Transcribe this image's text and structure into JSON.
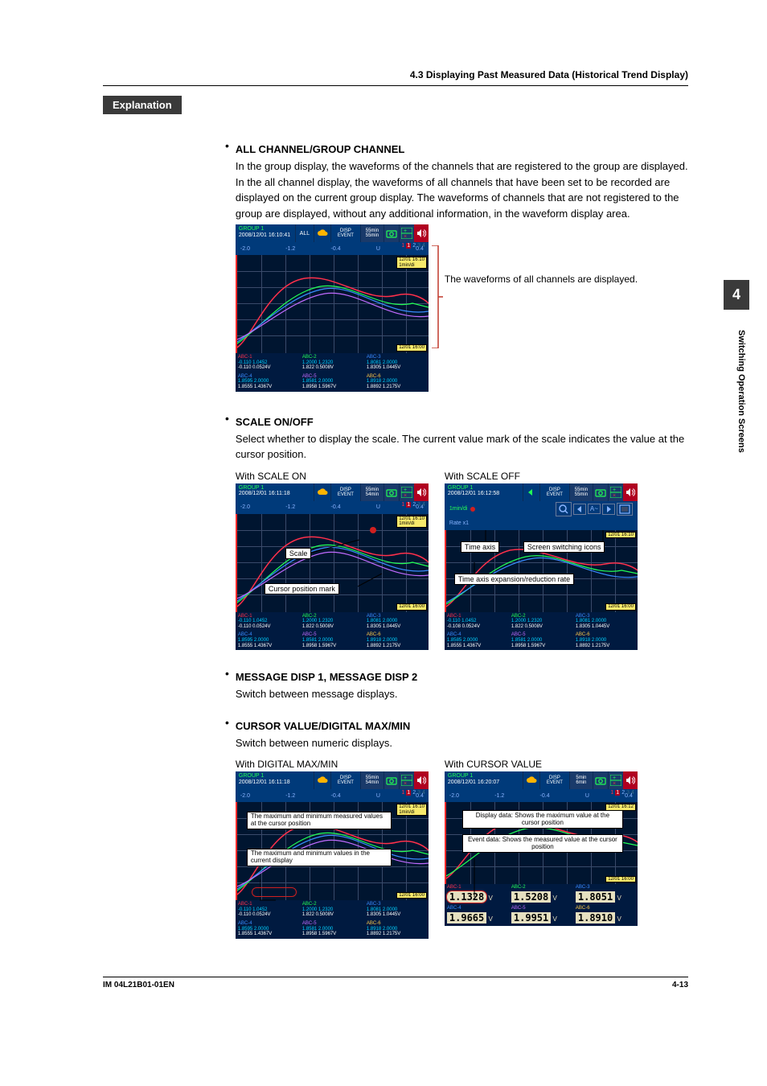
{
  "running_head": "4.3  Displaying Past Measured Data (Historical Trend Display)",
  "explanation_label": "Explanation",
  "side_tab": "4",
  "side_text": "Switching Operation Screens",
  "footer_left": "IM 04L21B01-01EN",
  "footer_right": "4-13",
  "sec1": {
    "title": "ALL CHANNEL/GROUP CHANNEL",
    "body": "In the group display, the waveforms of the channels that are registered to the group are displayed. In the all channel display, the waveforms of all channels that have been set to be recorded are displayed on the current group display. The waveforms of channels that are not registered to the group are displayed, without any additional information, in the waveform display area.",
    "callout": "The waveforms of all channels are displayed.",
    "fig": {
      "group": "GROUP 1",
      "datetime": "2008/12/01 16:10:41",
      "all": "ALL",
      "disp": "DISP",
      "event": "EVENT",
      "min1": "55min",
      "min2": "55min",
      "ticks": [
        "-2.0",
        "-1.2",
        "-0.4",
        "U",
        "0.4"
      ],
      "ind": [
        "1",
        "1",
        "2",
        "3",
        "4"
      ],
      "y1": "12/01 16:10",
      "y2": "1min/di",
      "yb": "12/01 16:00",
      "cells": [
        {
          "ch": "ABC-1",
          "c": "#ff304b",
          "a": "-0.110 1.0452",
          "b": "-0.110 0.0524V"
        },
        {
          "ch": "ABC-2",
          "c": "#22ff55",
          "a": "1.2000 1.2320",
          "b": "1.822 0.5008V"
        },
        {
          "ch": "ABC-3",
          "c": "#3a8bff",
          "a": "1.8081 2.0000",
          "b": "1.8305 1.0445V"
        },
        {
          "ch": "ABC-4",
          "c": "#3a8bff",
          "a": "1.8595 2.0000",
          "b": "1.8555 1.4367V"
        },
        {
          "ch": "ABC-5",
          "c": "#c26bff",
          "a": "1.8581 2.0000",
          "b": "1.8958 1.5967V"
        },
        {
          "ch": "ABC-6",
          "c": "#ffc84a",
          "a": "1.8918 2.0000",
          "b": "1.8892 1.2175V"
        }
      ]
    }
  },
  "sec2": {
    "title": "SCALE ON/OFF",
    "body": "Select whether to display the scale. The current value mark of the scale indicates the value at the cursor position.",
    "cap_on": "With SCALE ON",
    "cap_off": "With SCALE OFF",
    "label_scale": "Scale",
    "label_cursor": "Cursor position mark",
    "label_timeaxis": "Time axis",
    "label_switch": "Screen switching icons",
    "label_rate": "Time axis expansion/reduction rate",
    "fig_on": {
      "group": "GROUP 1",
      "datetime": "2008/12/01 16:11:18",
      "disp": "DISP",
      "event": "EVENT",
      "min1": "55min",
      "min2": "54min",
      "ticks": [
        "-2.0",
        "-1.2",
        "-0.4",
        "U",
        "0.4"
      ],
      "ind": [
        "1",
        "1",
        "2",
        "3",
        "4"
      ],
      "y1": "12/01 16:10",
      "y2": "1min/di",
      "yb": "12/01 16:00",
      "cells": [
        {
          "ch": "ABC-1",
          "c": "#ff304b",
          "a": "-0.110 1.0452",
          "b": "-0.110 0.0524V"
        },
        {
          "ch": "ABC-2",
          "c": "#22ff55",
          "a": "1.2000 1.2320",
          "b": "1.822 0.5008V"
        },
        {
          "ch": "ABC-3",
          "c": "#3a8bff",
          "a": "1.8081 2.0000",
          "b": "1.8305 1.0445V"
        },
        {
          "ch": "ABC-4",
          "c": "#3a8bff",
          "a": "1.8595 2.0000",
          "b": "1.8555 1.4367V"
        },
        {
          "ch": "ABC-5",
          "c": "#c26bff",
          "a": "1.8581 2.0000",
          "b": "1.8958 1.5967V"
        },
        {
          "ch": "ABC-6",
          "c": "#ffc84a",
          "a": "1.8918 2.0000",
          "b": "1.8892 1.2175V"
        }
      ]
    },
    "fig_off": {
      "group": "GROUP 1",
      "datetime": "2008/12/01 16:12:58",
      "disp": "DISP",
      "event": "EVENT",
      "min1": "55min",
      "min2": "55min",
      "div": "1min/di",
      "rate": "Rate x1",
      "y1": "12/01 16:10",
      "yb": "12/01 16:00",
      "cells": [
        {
          "ch": "ABC-1",
          "c": "#ff304b",
          "a": "-0.110 1.0452",
          "b": "-0.108 0.0524V"
        },
        {
          "ch": "ABC-2",
          "c": "#22ff55",
          "a": "1.2000 1.2320",
          "b": "1.822 0.5008V"
        },
        {
          "ch": "ABC-3",
          "c": "#3a8bff",
          "a": "1.8081 2.0000",
          "b": "1.8305 1.0445V"
        },
        {
          "ch": "ABC-4",
          "c": "#3a8bff",
          "a": "1.8585 2.0000",
          "b": "1.8555 1.4367V"
        },
        {
          "ch": "ABC-5",
          "c": "#c26bff",
          "a": "1.8581 2.0000",
          "b": "1.8958 1.5967V"
        },
        {
          "ch": "ABC-6",
          "c": "#ffc84a",
          "a": "1.8918 2.0000",
          "b": "1.8892 1.2175V"
        }
      ]
    }
  },
  "sec3": {
    "title": "MESSAGE DISP 1, MESSAGE DISP 2",
    "body": "Switch between message displays."
  },
  "sec4": {
    "title": "CURSOR VALUE/DIGITAL MAX/MIN",
    "body": "Switch between numeric displays.",
    "cap_left": "With DIGITAL MAX/MIN",
    "cap_right": "With CURSOR VALUE",
    "left": {
      "group": "GROUP 1",
      "datetime": "2008/12/01 16:11:18",
      "disp": "DISP",
      "event": "EVENT",
      "min1": "55min",
      "min2": "54min",
      "ticks": [
        "-2.0",
        "-1.2",
        "-0.4",
        "U",
        "0.4"
      ],
      "ind": [
        "1",
        "1",
        "2",
        "3",
        "4"
      ],
      "y1": "12/01 16:10",
      "y2": "1min/di",
      "yb": "12/01 16:00",
      "cbox1": "The maximum and minimum measured values at the cursor position",
      "cbox2": "The maximum and minimum values in the current display",
      "cells": [
        {
          "ch": "ABC-1",
          "c": "#ff304b",
          "a": "-0.110 1.0452",
          "b": "-0.110 0.0524V"
        },
        {
          "ch": "ABC-2",
          "c": "#22ff55",
          "a": "1.2000 1.2320",
          "b": "1.822 0.5008V"
        },
        {
          "ch": "ABC-3",
          "c": "#3a8bff",
          "a": "1.8081 2.0000",
          "b": "1.8305 1.0445V"
        },
        {
          "ch": "ABC-4",
          "c": "#3a8bff",
          "a": "1.8595 2.0000",
          "b": "1.8555 1.4367V"
        },
        {
          "ch": "ABC-5",
          "c": "#c26bff",
          "a": "1.8581 2.0000",
          "b": "1.8958 1.5967V"
        },
        {
          "ch": "ABC-6",
          "c": "#ffc84a",
          "a": "1.8918 2.0000",
          "b": "1.8892 1.2175V"
        }
      ]
    },
    "right": {
      "group": "GROUP 1",
      "datetime": "2008/12/01 16:20:07",
      "disp": "DISP",
      "event": "EVENT",
      "min1": "5min",
      "min2": "6min",
      "ticks": [
        "-2.0",
        "-1.2",
        "-0.4",
        "U",
        "0.4"
      ],
      "ind": [
        "1",
        "1",
        "2",
        "3",
        "4"
      ],
      "y1": "12/01 16:12",
      "yb": "12/01 16:00",
      "cbox1": "Display data: Shows the maximum value at the cursor position",
      "cbox2": "Event data: Shows the measured value at the cursor position",
      "digits": [
        {
          "ch": "ABC-1",
          "c": "#ff304b",
          "v": "1.1328",
          "u": "V",
          "hl": true
        },
        {
          "ch": "ABC-2",
          "c": "#22ff55",
          "v": "1.5208",
          "u": "V"
        },
        {
          "ch": "ABC-3",
          "c": "#3a8bff",
          "v": "1.8051",
          "u": "V"
        },
        {
          "ch": "ABC-4",
          "c": "#3a8bff",
          "v": "1.9665",
          "u": "V"
        },
        {
          "ch": "ABC-5",
          "c": "#c26bff",
          "v": "1.9951",
          "u": "V"
        },
        {
          "ch": "ABC-6",
          "c": "#ffc84a",
          "v": "1.8910",
          "u": "V"
        }
      ]
    }
  }
}
